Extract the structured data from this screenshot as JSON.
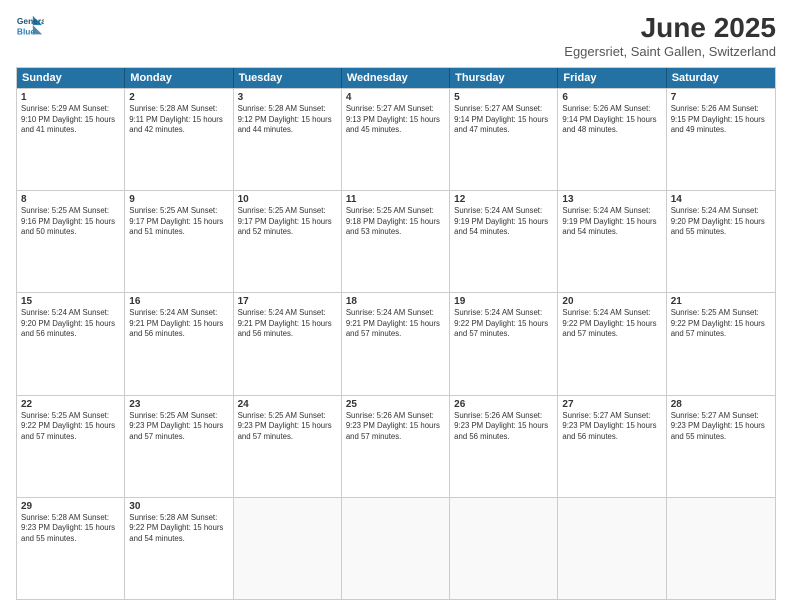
{
  "header": {
    "logo_line1": "General",
    "logo_line2": "Blue",
    "main_title": "June 2025",
    "subtitle": "Eggersriet, Saint Gallen, Switzerland"
  },
  "calendar": {
    "weekdays": [
      "Sunday",
      "Monday",
      "Tuesday",
      "Wednesday",
      "Thursday",
      "Friday",
      "Saturday"
    ],
    "rows": [
      [
        {
          "day": "",
          "info": ""
        },
        {
          "day": "2",
          "info": "Sunrise: 5:28 AM\nSunset: 9:11 PM\nDaylight: 15 hours\nand 42 minutes."
        },
        {
          "day": "3",
          "info": "Sunrise: 5:28 AM\nSunset: 9:12 PM\nDaylight: 15 hours\nand 44 minutes."
        },
        {
          "day": "4",
          "info": "Sunrise: 5:27 AM\nSunset: 9:13 PM\nDaylight: 15 hours\nand 45 minutes."
        },
        {
          "day": "5",
          "info": "Sunrise: 5:27 AM\nSunset: 9:14 PM\nDaylight: 15 hours\nand 47 minutes."
        },
        {
          "day": "6",
          "info": "Sunrise: 5:26 AM\nSunset: 9:14 PM\nDaylight: 15 hours\nand 48 minutes."
        },
        {
          "day": "7",
          "info": "Sunrise: 5:26 AM\nSunset: 9:15 PM\nDaylight: 15 hours\nand 49 minutes."
        }
      ],
      [
        {
          "day": "1",
          "info": "Sunrise: 5:29 AM\nSunset: 9:10 PM\nDaylight: 15 hours\nand 41 minutes."
        },
        {
          "day": "",
          "info": ""
        },
        {
          "day": "",
          "info": ""
        },
        {
          "day": "",
          "info": ""
        },
        {
          "day": "",
          "info": ""
        },
        {
          "day": "",
          "info": ""
        },
        {
          "day": "",
          "info": ""
        }
      ],
      [
        {
          "day": "8",
          "info": "Sunrise: 5:25 AM\nSunset: 9:16 PM\nDaylight: 15 hours\nand 50 minutes."
        },
        {
          "day": "9",
          "info": "Sunrise: 5:25 AM\nSunset: 9:17 PM\nDaylight: 15 hours\nand 51 minutes."
        },
        {
          "day": "10",
          "info": "Sunrise: 5:25 AM\nSunset: 9:17 PM\nDaylight: 15 hours\nand 52 minutes."
        },
        {
          "day": "11",
          "info": "Sunrise: 5:25 AM\nSunset: 9:18 PM\nDaylight: 15 hours\nand 53 minutes."
        },
        {
          "day": "12",
          "info": "Sunrise: 5:24 AM\nSunset: 9:19 PM\nDaylight: 15 hours\nand 54 minutes."
        },
        {
          "day": "13",
          "info": "Sunrise: 5:24 AM\nSunset: 9:19 PM\nDaylight: 15 hours\nand 54 minutes."
        },
        {
          "day": "14",
          "info": "Sunrise: 5:24 AM\nSunset: 9:20 PM\nDaylight: 15 hours\nand 55 minutes."
        }
      ],
      [
        {
          "day": "15",
          "info": "Sunrise: 5:24 AM\nSunset: 9:20 PM\nDaylight: 15 hours\nand 56 minutes."
        },
        {
          "day": "16",
          "info": "Sunrise: 5:24 AM\nSunset: 9:21 PM\nDaylight: 15 hours\nand 56 minutes."
        },
        {
          "day": "17",
          "info": "Sunrise: 5:24 AM\nSunset: 9:21 PM\nDaylight: 15 hours\nand 56 minutes."
        },
        {
          "day": "18",
          "info": "Sunrise: 5:24 AM\nSunset: 9:21 PM\nDaylight: 15 hours\nand 57 minutes."
        },
        {
          "day": "19",
          "info": "Sunrise: 5:24 AM\nSunset: 9:22 PM\nDaylight: 15 hours\nand 57 minutes."
        },
        {
          "day": "20",
          "info": "Sunrise: 5:24 AM\nSunset: 9:22 PM\nDaylight: 15 hours\nand 57 minutes."
        },
        {
          "day": "21",
          "info": "Sunrise: 5:25 AM\nSunset: 9:22 PM\nDaylight: 15 hours\nand 57 minutes."
        }
      ],
      [
        {
          "day": "22",
          "info": "Sunrise: 5:25 AM\nSunset: 9:22 PM\nDaylight: 15 hours\nand 57 minutes."
        },
        {
          "day": "23",
          "info": "Sunrise: 5:25 AM\nSunset: 9:23 PM\nDaylight: 15 hours\nand 57 minutes."
        },
        {
          "day": "24",
          "info": "Sunrise: 5:25 AM\nSunset: 9:23 PM\nDaylight: 15 hours\nand 57 minutes."
        },
        {
          "day": "25",
          "info": "Sunrise: 5:26 AM\nSunset: 9:23 PM\nDaylight: 15 hours\nand 57 minutes."
        },
        {
          "day": "26",
          "info": "Sunrise: 5:26 AM\nSunset: 9:23 PM\nDaylight: 15 hours\nand 56 minutes."
        },
        {
          "day": "27",
          "info": "Sunrise: 5:27 AM\nSunset: 9:23 PM\nDaylight: 15 hours\nand 56 minutes."
        },
        {
          "day": "28",
          "info": "Sunrise: 5:27 AM\nSunset: 9:23 PM\nDaylight: 15 hours\nand 55 minutes."
        }
      ],
      [
        {
          "day": "29",
          "info": "Sunrise: 5:28 AM\nSunset: 9:23 PM\nDaylight: 15 hours\nand 55 minutes."
        },
        {
          "day": "30",
          "info": "Sunrise: 5:28 AM\nSunset: 9:22 PM\nDaylight: 15 hours\nand 54 minutes."
        },
        {
          "day": "",
          "info": ""
        },
        {
          "day": "",
          "info": ""
        },
        {
          "day": "",
          "info": ""
        },
        {
          "day": "",
          "info": ""
        },
        {
          "day": "",
          "info": ""
        }
      ]
    ]
  }
}
